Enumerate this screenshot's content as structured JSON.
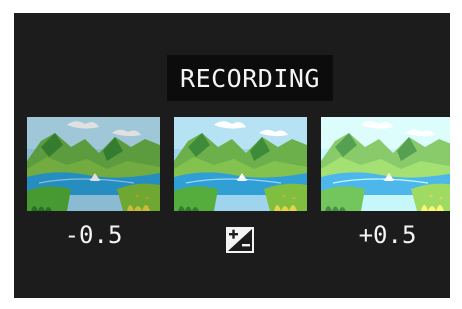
{
  "screen": {
    "title": "RECORDING"
  },
  "bracket": {
    "frames": [
      {
        "label": "-0.5",
        "image": "landscape-thumbnail-darker"
      },
      {
        "label": "",
        "image": "landscape-thumbnail-normal",
        "icon": "exposure-compensation-icon"
      },
      {
        "label": "+0.5",
        "image": "landscape-thumbnail-brighter"
      }
    ]
  },
  "colors": {
    "background": "#1c1c1c",
    "title_box": "#0c0c0c",
    "text": "#f4f4f4"
  }
}
